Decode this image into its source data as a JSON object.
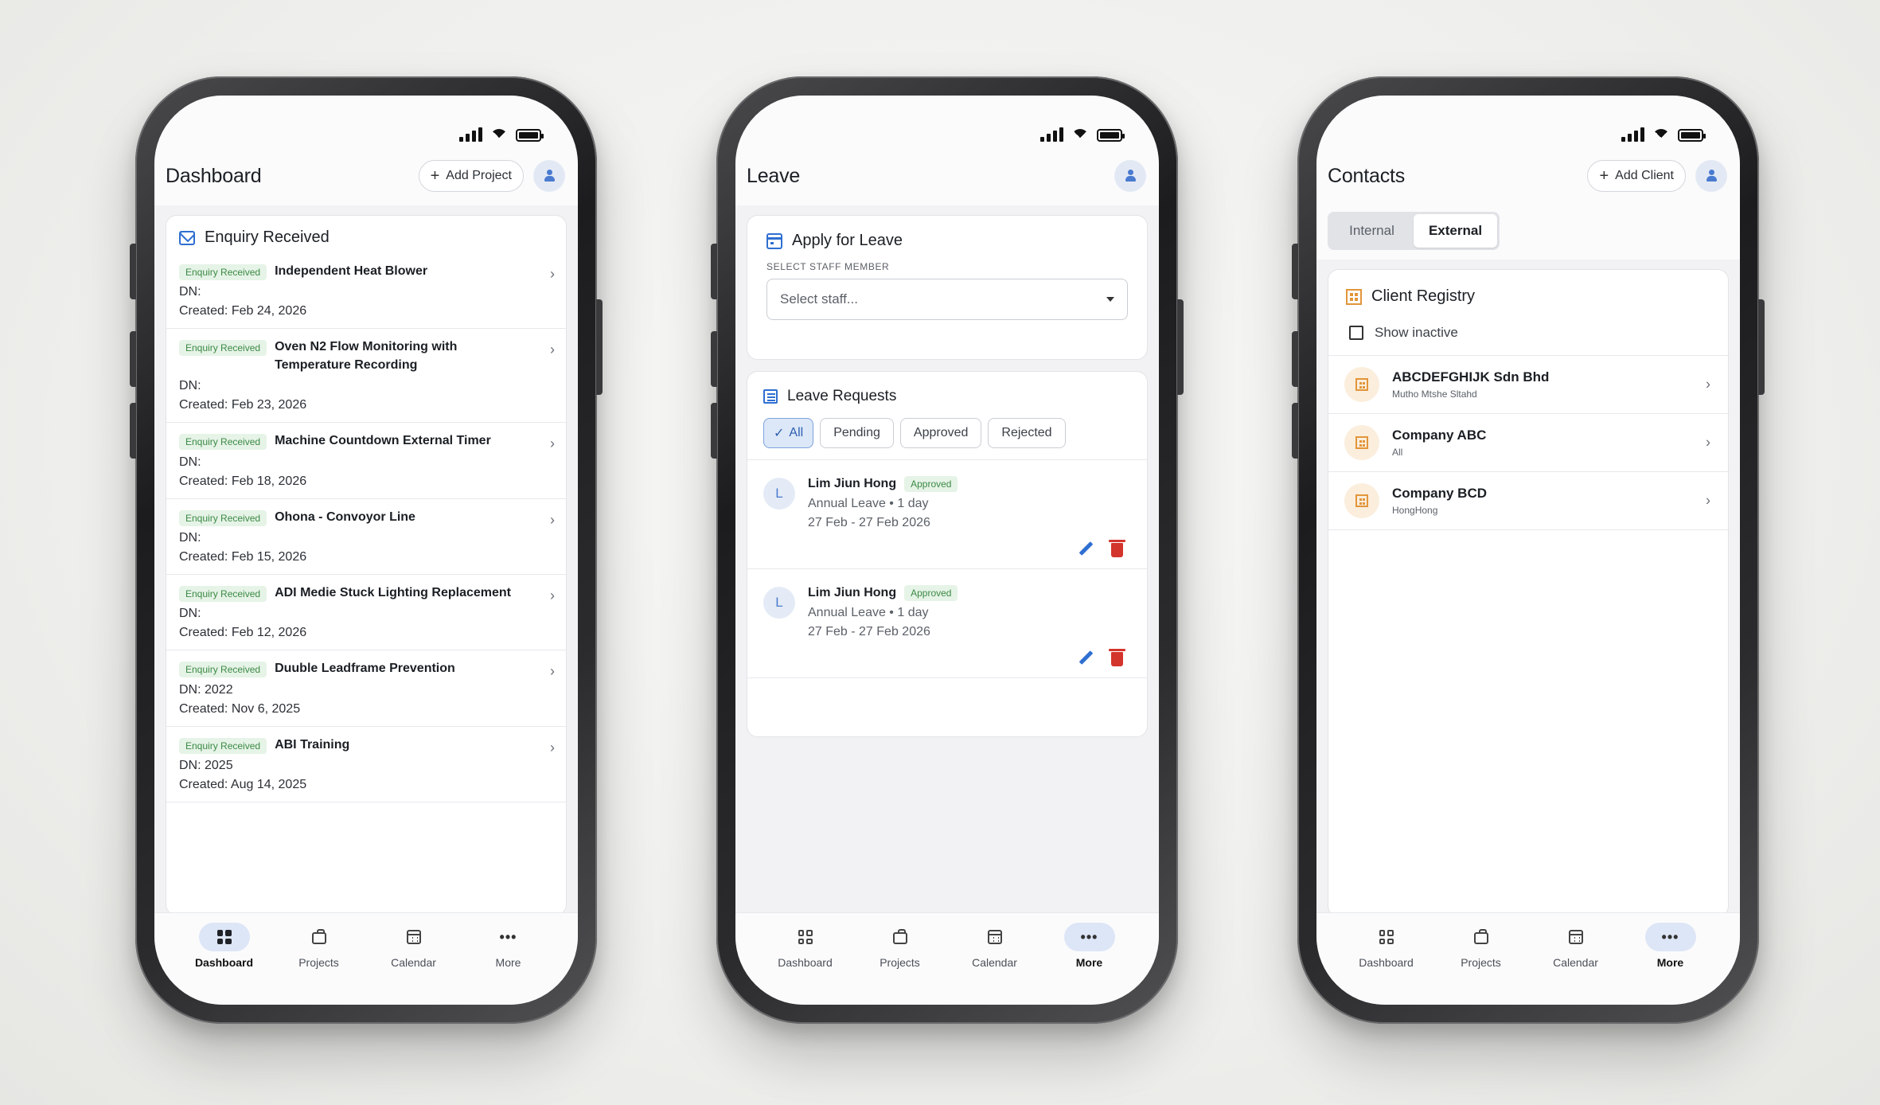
{
  "colors": {
    "accent": "#2f6fd1",
    "success": "#3b8a44",
    "danger": "#d3342c",
    "client": "#e2953a"
  },
  "phone1": {
    "title": "Dashboard",
    "add_button": "Add Project",
    "card_title": "Enquiry Received",
    "items": [
      {
        "badge": "Enquiry Received",
        "name": "Independent Heat Blower",
        "dn": "DN:",
        "created": "Created: Feb 24, 2026"
      },
      {
        "badge": "Enquiry Received",
        "name": "Oven N2 Flow Monitoring with Temperature Recording",
        "dn": "DN:",
        "created": "Created: Feb 23, 2026"
      },
      {
        "badge": "Enquiry Received",
        "name": "Machine Countdown External Timer",
        "dn": "DN:",
        "created": "Created: Feb 18, 2026"
      },
      {
        "badge": "Enquiry Received",
        "name": "Ohona - Convoyor Line",
        "dn": "DN:",
        "created": "Created: Feb 15, 2026"
      },
      {
        "badge": "Enquiry Received",
        "name": "ADI Medie Stuck Lighting Replacement",
        "dn": "DN:",
        "created": "Created: Feb 12, 2026"
      },
      {
        "badge": "Enquiry Received",
        "name": "Duuble Leadframe Prevention",
        "dn": "DN: 2022",
        "created": "Created: Nov 6, 2025"
      },
      {
        "badge": "Enquiry Received",
        "name": "ABI Training",
        "dn": "DN: 2025",
        "created": "Created: Aug 14, 2025"
      }
    ]
  },
  "phone2": {
    "title": "Leave",
    "apply_title": "Apply for Leave",
    "staff_label": "SELECT STAFF MEMBER",
    "staff_placeholder": "Select staff...",
    "requests_title": "Leave Requests",
    "filters": [
      "All",
      "Pending",
      "Approved",
      "Rejected"
    ],
    "requests": [
      {
        "initial": "L",
        "name": "Lim Jiun Hong",
        "status": "Approved",
        "type": "Annual Leave • 1 day",
        "dates": "27 Feb - 27 Feb 2026"
      },
      {
        "initial": "L",
        "name": "Lim Jiun Hong",
        "status": "Approved",
        "type": "Annual Leave • 1 day",
        "dates": "27 Feb - 27 Feb 2026"
      }
    ]
  },
  "phone3": {
    "title": "Contacts",
    "add_button": "Add Client",
    "tabs": [
      "Internal",
      "External"
    ],
    "registry_title": "Client Registry",
    "show_inactive": "Show inactive",
    "clients": [
      {
        "name": "ABCDEFGHIJK Sdn Bhd",
        "sub": "Mutho Mtshe Sltahd"
      },
      {
        "name": "Company ABC",
        "sub": "All"
      },
      {
        "name": "Company BCD",
        "sub": "HongHong"
      }
    ]
  },
  "nav": {
    "dashboard": "Dashboard",
    "projects": "Projects",
    "calendar": "Calendar",
    "more": "More"
  }
}
